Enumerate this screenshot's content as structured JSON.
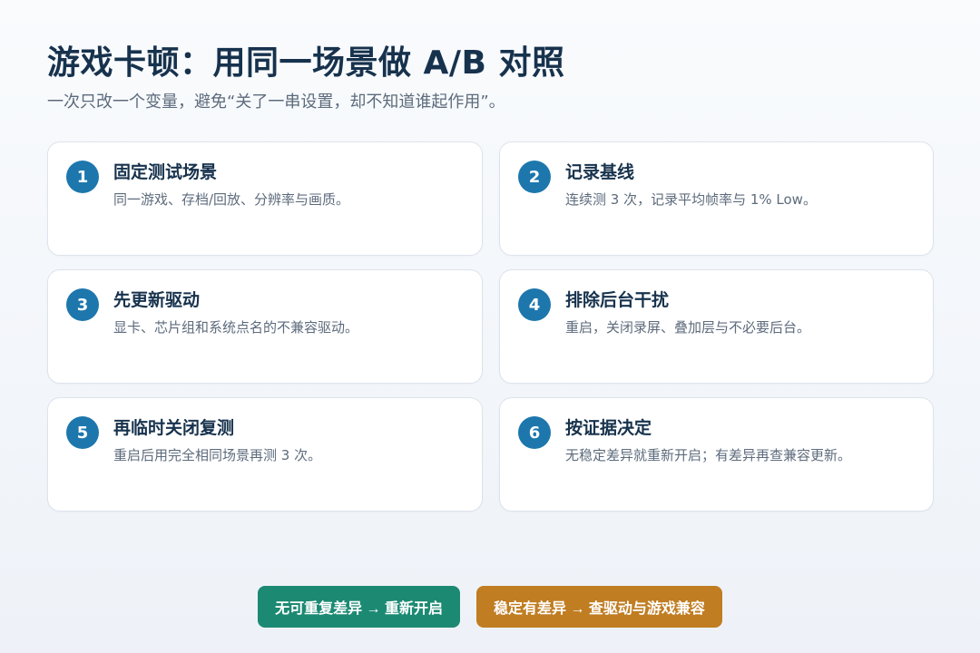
{
  "header": {
    "title": "游戏卡顿：用同一场景做 A/B 对照",
    "subtitle": "一次只改一个变量，避免“关了一串设置，却不知道谁起作用”。"
  },
  "steps": [
    {
      "number": "1",
      "title": "固定测试场景",
      "desc": "同一游戏、存档/回放、分辨率与画质。"
    },
    {
      "number": "2",
      "title": "记录基线",
      "desc": "连续测 3 次，记录平均帧率与 1% Low。"
    },
    {
      "number": "3",
      "title": "先更新驱动",
      "desc": "显卡、芯片组和系统点名的不兼容驱动。"
    },
    {
      "number": "4",
      "title": "排除后台干扰",
      "desc": "重启，关闭录屏、叠加层与不必要后台。"
    },
    {
      "number": "5",
      "title": "再临时关闭复测",
      "desc": "重启后用完全相同场景再测 3 次。"
    },
    {
      "number": "6",
      "title": "按证据决定",
      "desc": "无稳定差异就重新开启；有差异再查兼容更新。"
    }
  ],
  "actions": {
    "no_difference": "无可重复差异 → 重新开启",
    "stable_difference": "稳定有差异 → 查驱动与游戏兼容"
  },
  "colors": {
    "badge": "#1d77ad",
    "button_green": "#1c8a73",
    "button_orange": "#c07d22",
    "title": "#17324d"
  }
}
